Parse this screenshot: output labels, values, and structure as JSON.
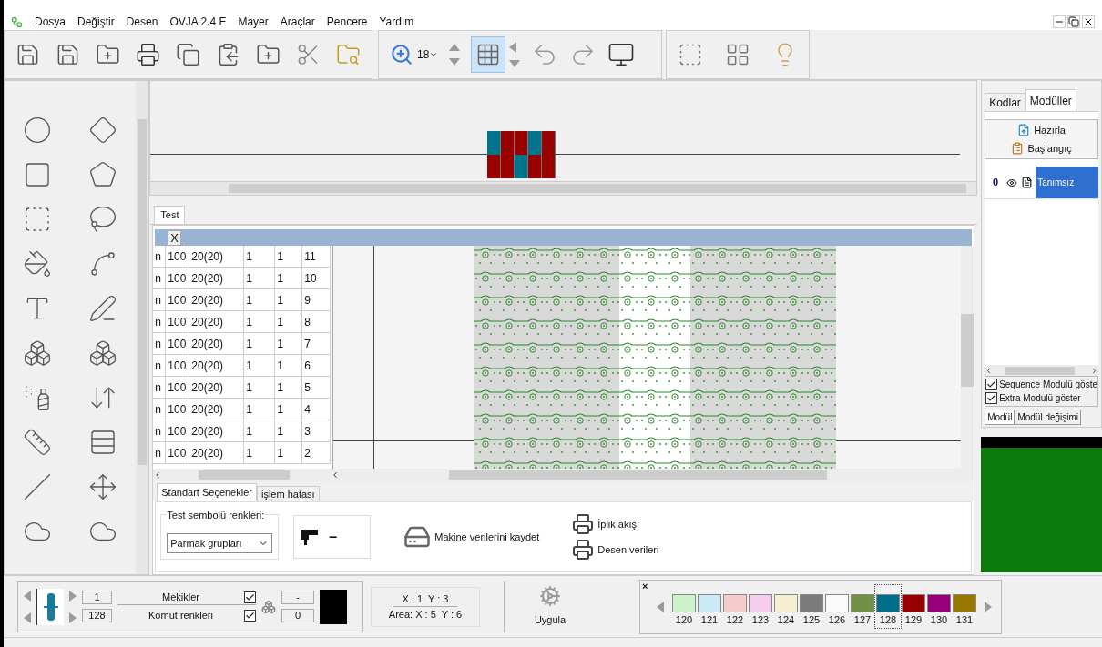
{
  "menu": {
    "items": [
      "Dosya",
      "Değiştir",
      "Desen",
      "OVJA 2.4 E",
      "Mayer",
      "Araçlar",
      "Pencere",
      "Yardım"
    ]
  },
  "toolbar": {
    "zoom": "18"
  },
  "preview": {
    "rows": [
      {
        "cells": [
          {
            "color": "#00748c"
          },
          {
            "color": "#990000"
          },
          {
            "color": "#990000"
          },
          {
            "color": "#00748c"
          },
          {
            "color": "#990000"
          }
        ]
      },
      {
        "cells": [
          {
            "color": "#990000"
          },
          {
            "color": "#990000"
          },
          {
            "color": "#00748c"
          },
          {
            "color": "#990000"
          },
          {
            "color": "#990000"
          }
        ]
      }
    ]
  },
  "test_panel": {
    "tab": "Test",
    "close": "X",
    "rows": [
      {
        "cells": [
          "n",
          "100",
          "20(20)",
          "1",
          "1",
          "11"
        ]
      },
      {
        "cells": [
          "n",
          "100",
          "20(20)",
          "1",
          "1",
          "10"
        ]
      },
      {
        "cells": [
          "n",
          "100",
          "20(20)",
          "1",
          "1",
          "9"
        ]
      },
      {
        "cells": [
          "n",
          "100",
          "20(20)",
          "1",
          "1",
          "8"
        ]
      },
      {
        "cells": [
          "n",
          "100",
          "20(20)",
          "1",
          "1",
          "7"
        ]
      },
      {
        "cells": [
          "n",
          "100",
          "20(20)",
          "1",
          "1",
          "6"
        ]
      },
      {
        "cells": [
          "n",
          "100",
          "20(20)",
          "1",
          "1",
          "5"
        ]
      },
      {
        "cells": [
          "n",
          "100",
          "20(20)",
          "1",
          "1",
          "4"
        ]
      },
      {
        "cells": [
          "n",
          "100",
          "20(20)",
          "1",
          "1",
          "3"
        ]
      },
      {
        "cells": [
          "n",
          "100",
          "20(20)",
          "1",
          "1",
          "2"
        ]
      }
    ]
  },
  "bottom_tabs": [
    {
      "label": "Standart Seçenekler",
      "selected": true
    },
    {
      "label": "işlem hatası",
      "selected": false
    }
  ],
  "options": {
    "group_label": "Test sembolü renkleri:",
    "dropdown": "Parmak grupları",
    "symbol": "–",
    "save_button": "Makine verilerini kaydet",
    "print_buttons": [
      "İplik akışı",
      "Desen verileri"
    ]
  },
  "right_panel": {
    "tabs": [
      {
        "label": "Kodlar",
        "selected": false
      },
      {
        "label": "Modüller",
        "selected": true
      }
    ],
    "buttons": [
      "Hazırla",
      "Başlangıç"
    ],
    "module": {
      "number": "0",
      "name": "Tanımsız",
      "selected": true
    },
    "checkboxes": [
      {
        "label": "Sequence Modulü göste",
        "checked": true
      },
      {
        "label": "Extra Modulü göster",
        "checked": true
      }
    ],
    "bottom_tabs": [
      {
        "label": "Modül",
        "selected": true
      },
      {
        "label": "Modül değişimi",
        "selected": false
      }
    ]
  },
  "status": {
    "value_1": "1",
    "value_2": "128",
    "checkboxes": [
      {
        "label": "Mekikler",
        "checked": true
      },
      {
        "label": "Komut renkleri",
        "checked": true
      }
    ],
    "field_1": "-",
    "field_2": "0",
    "coords": "X : 1  Y : 3",
    "area": "Area: X : 5  Y : 6",
    "apply": "Uygula",
    "close": "×"
  },
  "palette": [
    {
      "label": "120",
      "color": "#ccf2cc",
      "selected": false
    },
    {
      "label": "121",
      "color": "#cceaf5",
      "selected": false
    },
    {
      "label": "122",
      "color": "#f5cccc",
      "selected": false
    },
    {
      "label": "123",
      "color": "#f5ccee",
      "selected": false
    },
    {
      "label": "124",
      "color": "#f5eed0",
      "selected": false
    },
    {
      "label": "125",
      "color": "#7a7a7a",
      "selected": false
    },
    {
      "label": "126",
      "color": "#fafafa",
      "selected": false
    },
    {
      "label": "127",
      "color": "#719146",
      "selected": false
    },
    {
      "label": "128",
      "color": "#006e8a",
      "selected": true
    },
    {
      "label": "129",
      "color": "#960000",
      "selected": false
    },
    {
      "label": "130",
      "color": "#960078",
      "selected": false
    },
    {
      "label": "131",
      "color": "#967800",
      "selected": false
    }
  ]
}
